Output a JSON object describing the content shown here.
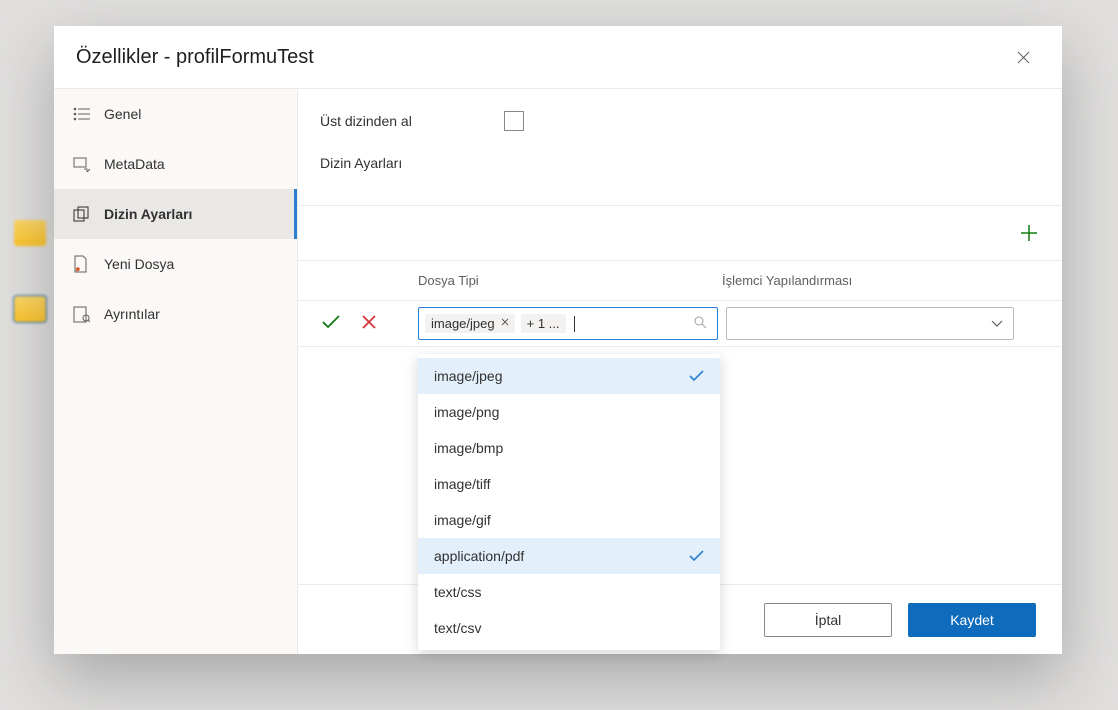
{
  "dialog": {
    "title": "Özellikler - profilFormuTest"
  },
  "sidebar": {
    "items": [
      {
        "label": "Genel",
        "icon": "list"
      },
      {
        "label": "MetaData",
        "icon": "metadata"
      },
      {
        "label": "Dizin Ayarları",
        "icon": "copy",
        "active": true
      },
      {
        "label": "Yeni Dosya",
        "icon": "new-file"
      },
      {
        "label": "Ayrıntılar",
        "icon": "details"
      }
    ]
  },
  "content": {
    "inherit_label": "Üst dizinden al",
    "inherit_checked": false,
    "section_title": "Dizin Ayarları",
    "columns": {
      "file_type": "Dosya Tipi",
      "processor": "İşlemci Yapılandırması"
    },
    "row": {
      "tags": [
        {
          "label": "image/jpeg"
        }
      ],
      "overflow_label": "+ 1 ..."
    },
    "dropdown_options": [
      {
        "label": "image/jpeg",
        "selected": true
      },
      {
        "label": "image/png",
        "selected": false
      },
      {
        "label": "image/bmp",
        "selected": false
      },
      {
        "label": "image/tiff",
        "selected": false
      },
      {
        "label": "image/gif",
        "selected": false
      },
      {
        "label": "application/pdf",
        "selected": true
      },
      {
        "label": "text/css",
        "selected": false
      },
      {
        "label": "text/csv",
        "selected": false
      }
    ]
  },
  "footer": {
    "cancel": "İptal",
    "save": "Kaydet"
  },
  "colors": {
    "accent": "#0f6cbd",
    "success": "#107c10",
    "danger": "#d13438"
  }
}
